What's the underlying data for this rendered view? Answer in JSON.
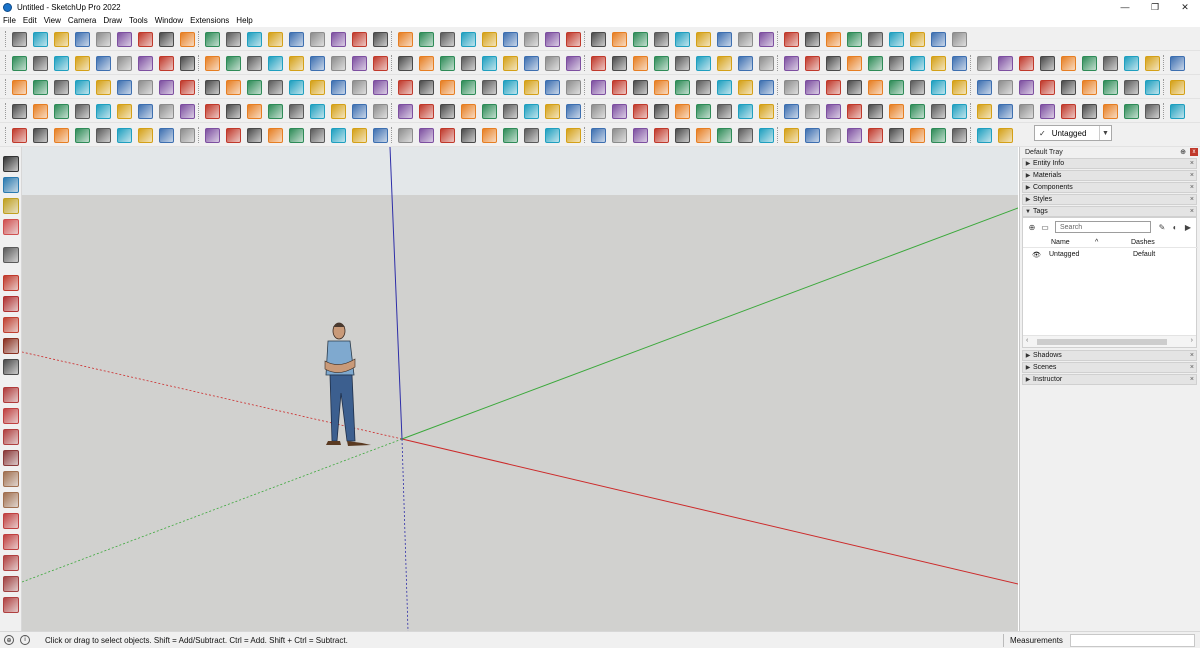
{
  "window": {
    "title": "Untitled - SketchUp Pro 2022",
    "minimize_glyph": "—",
    "restore_glyph": "❐",
    "close_glyph": "✕"
  },
  "menu": [
    "File",
    "Edit",
    "View",
    "Camera",
    "Draw",
    "Tools",
    "Window",
    "Extensions",
    "Help"
  ],
  "toolbar": {
    "tag_dropdown_value": "Untagged",
    "tag_dropdown_check": "✓"
  },
  "tray": {
    "title": "Default Tray",
    "pin_glyph": "⊕",
    "close_glyph": "x",
    "panels_top": [
      "Entity Info",
      "Materials",
      "Components",
      "Styles",
      "Tags"
    ],
    "panels_bottom": [
      "Shadows",
      "Scenes",
      "Instructor"
    ],
    "tags": {
      "search_placeholder": "Search",
      "col_name": "Name",
      "col_dashes": "Dashes",
      "rows": [
        {
          "name": "Untagged",
          "dashes": "Default"
        }
      ]
    }
  },
  "statusbar": {
    "message": "Click or drag to select objects. Shift = Add/Subtract. Ctrl = Add. Shift + Ctrl = Subtract.",
    "measurements_label": "Measurements",
    "measurements_value": ""
  },
  "colors": {
    "viewport_ground": "#d1d1cf",
    "viewport_sky": "#e2e6e8",
    "axis_red": "#cc2a2a",
    "axis_green": "#3aa83a",
    "axis_blue": "#2e2ea8",
    "toolbar_bg": "#f0f0f0"
  }
}
